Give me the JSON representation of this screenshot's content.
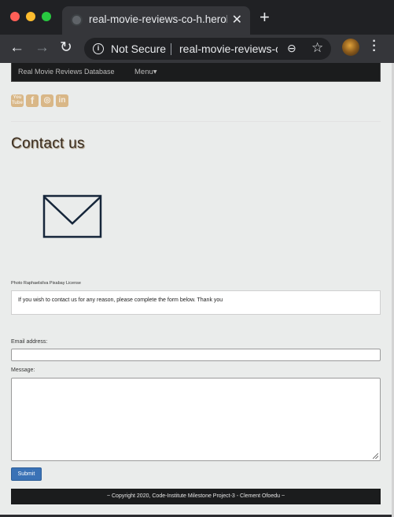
{
  "browser": {
    "tab_title": "real-movie-reviews-co-h.herokuapp.com",
    "security_label": "Not Secure",
    "url": "real-movie-reviews-co-h.herokuapp.com",
    "icons": [
      "back-arrow-icon",
      "forward-arrow-icon",
      "reload-icon",
      "info-icon",
      "zoom-icon",
      "star-icon",
      "kebab-menu-icon",
      "globe-icon",
      "close-icon",
      "plus-icon"
    ]
  },
  "site_nav": {
    "brand": "Real Movie Reviews Database",
    "menu_label": "Menu"
  },
  "social": {
    "icons": [
      "youtube-icon",
      "facebook-icon",
      "instagram-icon",
      "linkedin-icon"
    ],
    "youtube_top": "You",
    "youtube_bottom": "Tube",
    "facebook": "f",
    "instagram": "◎",
    "linkedin": "in",
    "color": "#d9b787"
  },
  "page": {
    "title": "Contact us",
    "photo_credit": "Photo Raphaelsilva Pixabay License",
    "intro_text": "If you wish to contact us for any reason, please complete the form below. Thank you"
  },
  "form": {
    "email_label": "Email address:",
    "email_value": "",
    "message_label": "Message:",
    "message_value": "",
    "submit_label": "Submit",
    "submit_color": "#3a72b6"
  },
  "footer": {
    "text": "~ Copyright 2020, Code-Institute Milestone Project-3 - Clement Ofoedu ~"
  }
}
